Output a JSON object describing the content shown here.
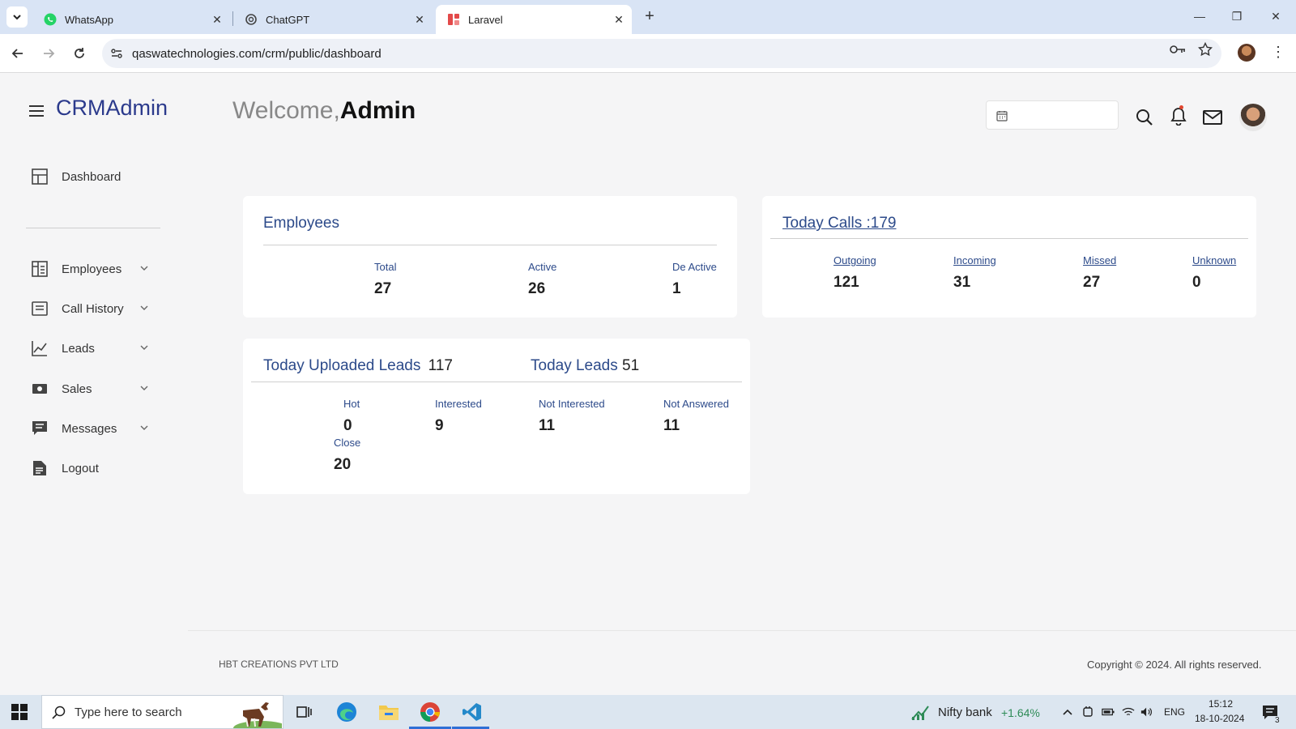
{
  "browser": {
    "tabs": [
      {
        "title": "WhatsApp",
        "icon": "whatsapp-icon"
      },
      {
        "title": "ChatGPT",
        "icon": "chatgpt-icon"
      },
      {
        "title": "Laravel",
        "icon": "laravel-icon",
        "active": true
      }
    ],
    "url": "qaswatechnologies.com/crm/public/dashboard"
  },
  "app": {
    "brand": "CRMAdmin",
    "welcome_prefix": "Welcome,",
    "welcome_name": "Admin",
    "sidebar": {
      "dashboard": "Dashboard",
      "items": [
        {
          "label": "Employees",
          "icon": "employees-icon"
        },
        {
          "label": "Call History",
          "icon": "call-history-icon"
        },
        {
          "label": "Leads",
          "icon": "leads-chart-icon"
        },
        {
          "label": "Sales",
          "icon": "sales-money-icon"
        },
        {
          "label": "Messages",
          "icon": "messages-icon"
        },
        {
          "label": "Logout",
          "icon": "logout-document-icon"
        }
      ]
    },
    "employees_card": {
      "title": "Employees",
      "stats": [
        {
          "label": "Total",
          "value": "27"
        },
        {
          "label": "Active",
          "value": "26"
        },
        {
          "label": "De Active",
          "value": "1"
        }
      ]
    },
    "calls_card": {
      "title": "Today Calls :179",
      "stats": [
        {
          "label": "Outgoing",
          "value": "121"
        },
        {
          "label": "Incoming",
          "value": "31"
        },
        {
          "label": "Missed",
          "value": "27"
        },
        {
          "label": "Unknown",
          "value": "0"
        }
      ]
    },
    "leads_card": {
      "uploaded_title": "Today Uploaded Leads",
      "uploaded_count": "117",
      "today_title": "Today Leads",
      "today_count": "51",
      "stats": [
        {
          "label": "Hot",
          "value": "0"
        },
        {
          "label": "Interested",
          "value": "9"
        },
        {
          "label": "Not Interested",
          "value": "11"
        },
        {
          "label": "Not Answered",
          "value": "11"
        },
        {
          "label": "Close",
          "value": "20"
        }
      ]
    },
    "footer": {
      "left": "HBT CREATIONS PVT LTD",
      "right": "Copyright © 2024. All rights reserved."
    }
  },
  "taskbar": {
    "search_placeholder": "Type here to search",
    "ticker_name": "Nifty bank",
    "ticker_change": "+1.64%",
    "language": "ENG",
    "time": "15:12",
    "date": "18-10-2024",
    "notification_count": "3"
  },
  "colors": {
    "accent": "#2c4a8a",
    "brand": "#2b3a8c",
    "ticker_up": "#2e8b57"
  }
}
